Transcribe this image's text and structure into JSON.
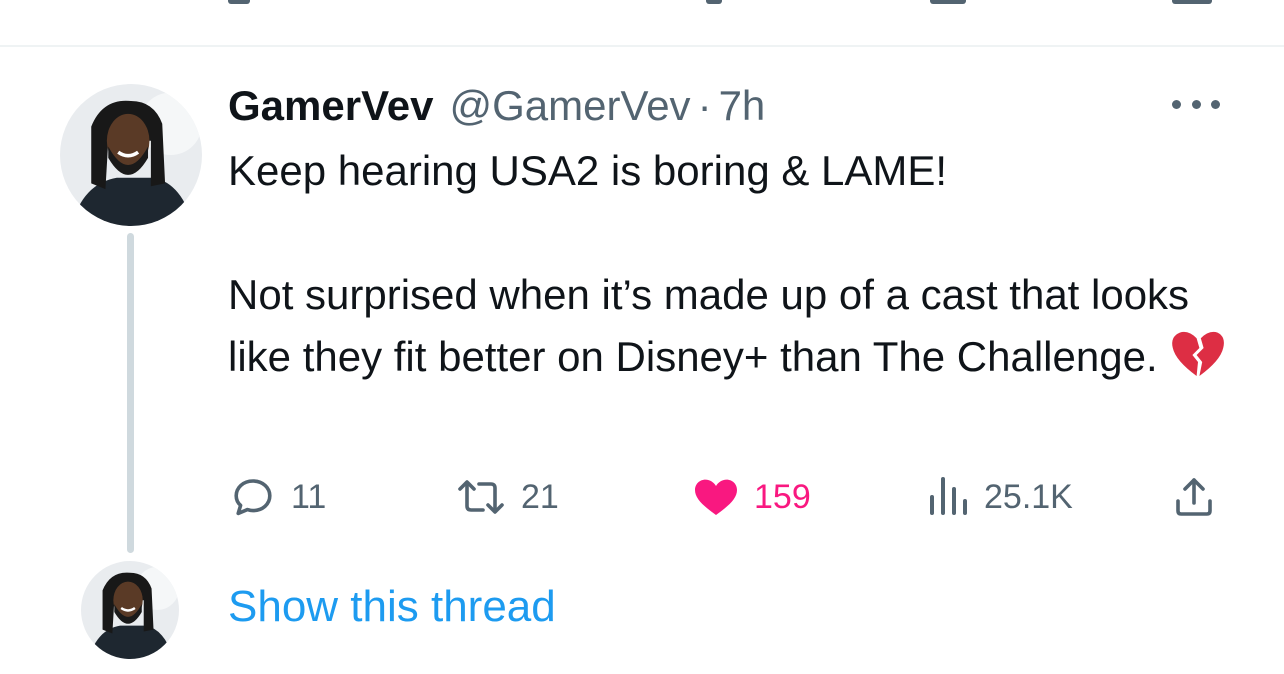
{
  "tweet": {
    "display_name": "GamerVev",
    "handle": "@GamerVev",
    "separator": "·",
    "time": "7h",
    "text_line1": "Keep hearing USA2 is boring & LAME!",
    "text_line2": "Not surprised when it’s made up of a cast that looks like they fit better on Disney+ than The Challenge.",
    "emoji": "broken-heart",
    "more_icon": "more-horizontal-icon",
    "avatar": "user-avatar-photo",
    "stats": {
      "replies": "11",
      "retweets": "21",
      "likes": "159",
      "views": "25.1K"
    },
    "liked": true
  },
  "thread": {
    "show_label": "Show this thread"
  },
  "colors": {
    "text": "#0f1419",
    "secondary": "#536471",
    "like": "#f91880",
    "link": "#1d9bf0",
    "thread_line": "#cfd9de"
  }
}
